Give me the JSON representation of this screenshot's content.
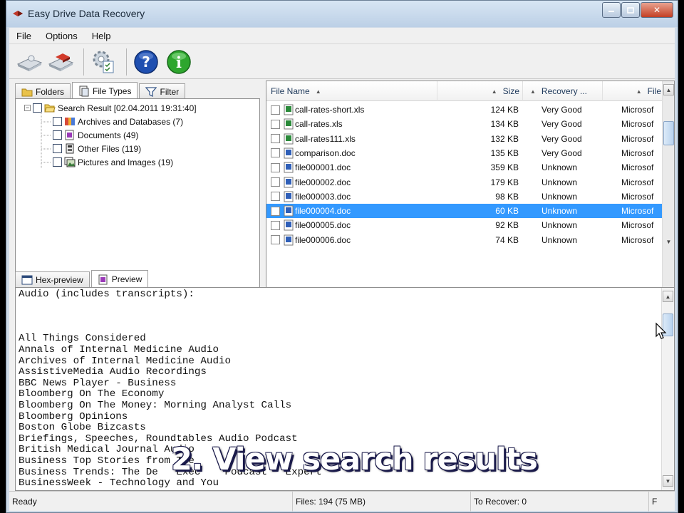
{
  "window": {
    "title": "Easy Drive Data Recovery"
  },
  "menu": [
    "File",
    "Options",
    "Help"
  ],
  "toolbar": {
    "buttons": [
      {
        "icon": "scan-drive-icon"
      },
      {
        "icon": "recover-drive-icon"
      },
      {
        "icon": "settings-icon"
      },
      {
        "icon": "help-icon"
      },
      {
        "icon": "info-icon"
      }
    ]
  },
  "left_tabs": [
    "Folders",
    "File Types",
    "Filter"
  ],
  "tree": {
    "root": "Search Result [02.04.2011 19:31:40]",
    "children": [
      "Archives and Databases (7)",
      "Documents (49)",
      "Other Files (119)",
      "Pictures and Images (19)"
    ]
  },
  "file_list": {
    "columns": [
      "File Name",
      "Size",
      "Recovery ...",
      "File"
    ],
    "rows": [
      {
        "name": "call-rates-short.xls",
        "size": "124 KB",
        "recovery": "Very Good",
        "type": "Microsof",
        "kind": "xls"
      },
      {
        "name": "call-rates.xls",
        "size": "134 KB",
        "recovery": "Very Good",
        "type": "Microsof",
        "kind": "xls"
      },
      {
        "name": "call-rates111.xls",
        "size": "132 KB",
        "recovery": "Very Good",
        "type": "Microsof",
        "kind": "xls"
      },
      {
        "name": "comparison.doc",
        "size": "135 KB",
        "recovery": "Very Good",
        "type": "Microsof",
        "kind": "doc"
      },
      {
        "name": "file000001.doc",
        "size": "359 KB",
        "recovery": "Unknown",
        "type": "Microsof",
        "kind": "doc"
      },
      {
        "name": "file000002.doc",
        "size": "179 KB",
        "recovery": "Unknown",
        "type": "Microsof",
        "kind": "doc"
      },
      {
        "name": "file000003.doc",
        "size": "98 KB",
        "recovery": "Unknown",
        "type": "Microsof",
        "kind": "doc"
      },
      {
        "name": "file000004.doc",
        "size": "60 KB",
        "recovery": "Unknown",
        "type": "Microsof",
        "kind": "doc",
        "selected": true
      },
      {
        "name": "file000005.doc",
        "size": "92 KB",
        "recovery": "Unknown",
        "type": "Microsof",
        "kind": "doc"
      },
      {
        "name": "file000006.doc",
        "size": "74 KB",
        "recovery": "Unknown",
        "type": "Microsof",
        "kind": "doc"
      }
    ]
  },
  "bottom_tabs": [
    "Hex-preview",
    "Preview"
  ],
  "preview": {
    "lines": [
      "Audio (includes transcripts):",
      "",
      "",
      "",
      "All Things Considered",
      "Annals of Internal Medicine Audio",
      "Archives of Internal Medicine Audio",
      "AssistiveMedia Audio Recordings",
      "BBC News Player - Business",
      "Bloomberg On The Economy",
      "Bloomberg On The Money: Morning Analyst Calls",
      "Bloomberg Opinions",
      "Boston Globe Bizcasts",
      "Briefings, Speeches, Roundtables Audio Podcast",
      "British Medical Journal Audio",
      "Business Top Stories from The",
      "Business Trends: The De   Exec    Podcast   Expert",
      "BusinessWeek - Technology and You"
    ]
  },
  "status": {
    "state": "Ready",
    "files": "Files: 194 (75 MB)",
    "to_recover": "To Recover: 0",
    "extra": "F"
  },
  "caption": "2. View search results",
  "colors": {
    "selection": "#3399ff",
    "help_blue": "#1f4fb0",
    "info_green": "#2ea62e"
  }
}
